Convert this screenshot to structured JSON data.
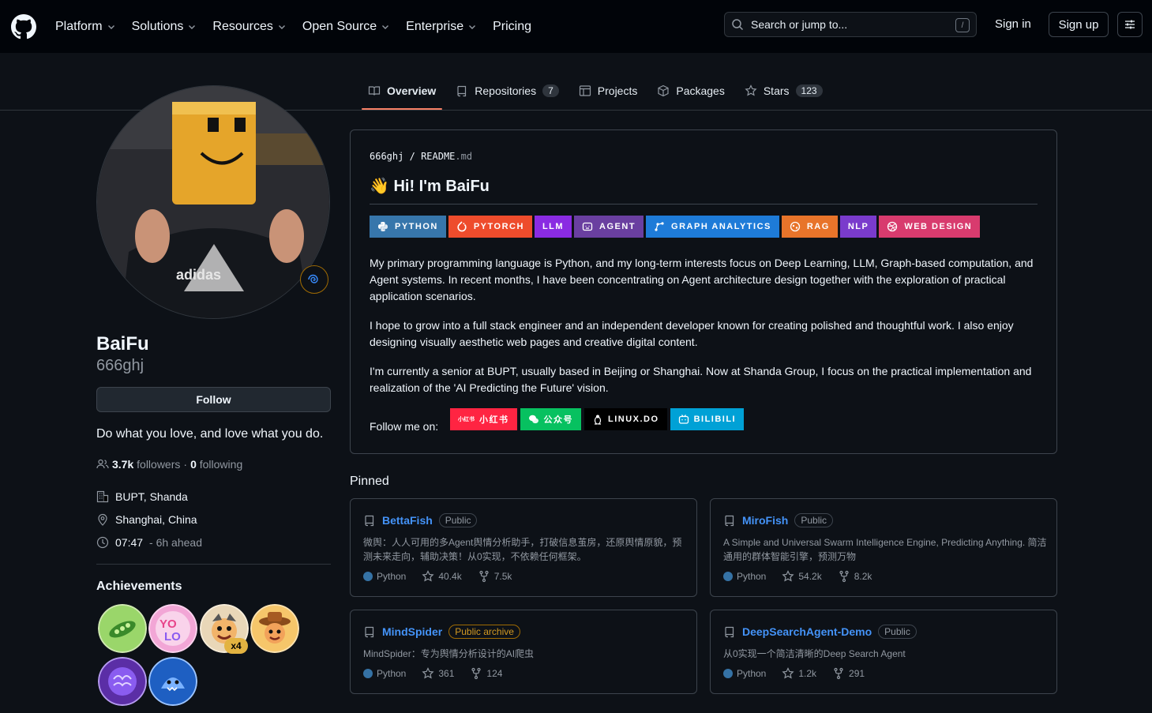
{
  "header": {
    "nav": [
      "Platform",
      "Solutions",
      "Resources",
      "Open Source",
      "Enterprise",
      "Pricing"
    ],
    "search_placeholder": "Search or jump to...",
    "search_kbd": "/",
    "signin": "Sign in",
    "signup": "Sign up"
  },
  "tabs": [
    {
      "label": "Overview",
      "icon": "book-icon"
    },
    {
      "label": "Repositories",
      "count": "7",
      "icon": "repo-icon"
    },
    {
      "label": "Projects",
      "icon": "table-icon"
    },
    {
      "label": "Packages",
      "icon": "package-icon"
    },
    {
      "label": "Stars",
      "count": "123",
      "icon": "star-icon"
    }
  ],
  "profile": {
    "name": "BaiFu",
    "login": "666ghj",
    "follow_label": "Follow",
    "bio": "Do what you love, and love what you do.",
    "followers_count": "3.7k",
    "followers_label": "followers",
    "separator": "·",
    "following_count": "0",
    "following_label": "following",
    "org": "BUPT, Shanda",
    "location": "Shanghai, China",
    "local_time": "07:47",
    "time_offset": "- 6h ahead",
    "achievements_title": "Achievements",
    "achievement_multiplier": "x4"
  },
  "readme": {
    "owner": "666ghj",
    "slash": "/",
    "file": "README",
    "ext": ".md",
    "wave": "👋",
    "heading": "Hi! I'm BaiFu",
    "shields": [
      {
        "label": "PYTHON",
        "color": "#3776AB"
      },
      {
        "label": "PYTORCH",
        "color": "#EE4C2C"
      },
      {
        "label": "LLM",
        "color": "#8A2BE2"
      },
      {
        "label": "AGENT",
        "color": "#6A3FA0"
      },
      {
        "label": "GRAPH ANALYTICS",
        "color": "#1E7BD8"
      },
      {
        "label": "RAG",
        "color": "#E8742A"
      },
      {
        "label": "NLP",
        "color": "#7A3BCC"
      },
      {
        "label": "WEB DESIGN",
        "color": "#D83B6E"
      }
    ],
    "paragraphs": [
      "My primary programming language is Python, and my long-term interests focus on Deep Learning, LLM, Graph-based computation, and Agent systems. In recent months, I have been concentrating on Agent architecture design together with the exploration of practical application scenarios.",
      "I hope to grow into a full stack engineer and an independent developer known for creating polished and thoughtful work. I also enjoy designing visually aesthetic web pages and creative digital content.",
      "I'm currently a senior at BUPT, usually based in Beijing or Shanghai. Now at Shanda Group, I focus on the practical implementation and realization of the 'AI Predicting the Future' vision."
    ],
    "follow_me": "Follow me on:",
    "socials": [
      {
        "label": "小红书",
        "logo": "小红书",
        "color": "#FF2442"
      },
      {
        "label": "公众号",
        "color": "#07C160"
      },
      {
        "label": "LINUX.DO",
        "color": "#000000"
      },
      {
        "label": "BILIBILI",
        "color": "#00A1D6"
      }
    ]
  },
  "pinned": {
    "title": "Pinned",
    "repos": [
      {
        "name": "BettaFish",
        "visibility": "Public",
        "desc": "微舆：人人可用的多Agent舆情分析助手，打破信息茧房，还原舆情原貌，预测未来走向，辅助决策！从0实现，不依赖任何框架。",
        "lang": "Python",
        "stars": "40.4k",
        "forks": "7.5k"
      },
      {
        "name": "MiroFish",
        "visibility": "Public",
        "desc": "A Simple and Universal Swarm Intelligence Engine, Predicting Anything. 简洁通用的群体智能引擎，预测万物",
        "lang": "Python",
        "stars": "54.2k",
        "forks": "8.2k"
      },
      {
        "name": "MindSpider",
        "visibility": "Public archive",
        "desc": "MindSpider：专为舆情分析设计的AI爬虫",
        "lang": "Python",
        "stars": "361",
        "forks": "124"
      },
      {
        "name": "DeepSearchAgent-Demo",
        "visibility": "Public",
        "desc": "从0实现一个简洁清晰的Deep Search Agent",
        "lang": "Python",
        "stars": "1.2k",
        "forks": "291"
      }
    ]
  }
}
